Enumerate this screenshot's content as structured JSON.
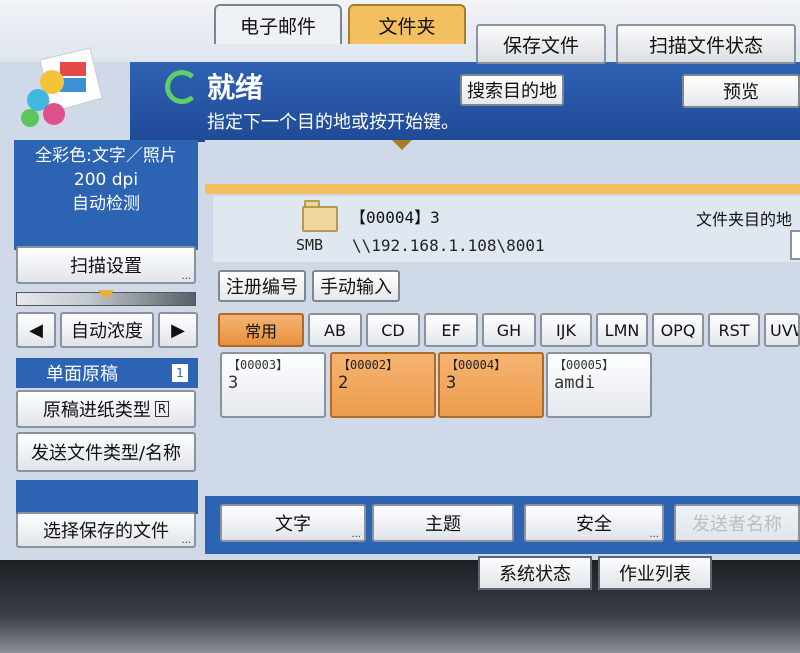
{
  "header": {
    "save_file": "保存文件",
    "scan_status": "扫描文件状态",
    "status": "就绪",
    "hint": "指定下一个目的地或按开始键。",
    "search_dest": "搜索目的地",
    "preview": "预览"
  },
  "left": {
    "color_mode": "全彩色:文字／照片",
    "resolution": "200 dpi",
    "auto_detect": "自动检测",
    "scan_settings": "扫描设置",
    "density_left": "◀",
    "density_label": "自动浓度",
    "density_right": "▶",
    "single_sided": "单面原稿",
    "single_sided_badge": "1",
    "feed_type": "原稿进纸类型",
    "feed_icon": "R",
    "send_type": "发送文件类型/名称",
    "select_saved": "选择保存的文件"
  },
  "tabs": [
    "电子邮件",
    "文件夹"
  ],
  "folder": {
    "id": "【00004】3",
    "protocol": "SMB",
    "path": "\\\\192.168.1.108\\8001",
    "dest_label": "文件夹目的地"
  },
  "actions": {
    "register_no": "注册编号",
    "manual_input": "手动输入"
  },
  "index_tabs": [
    "常用",
    "AB",
    "CD",
    "EF",
    "GH",
    "IJK",
    "LMN",
    "OPQ",
    "RST",
    "UVW"
  ],
  "entries": [
    {
      "num": "【00003】",
      "val": "3",
      "selected": false
    },
    {
      "num": "【00002】",
      "val": "2",
      "selected": true
    },
    {
      "num": "【00004】",
      "val": "3",
      "selected": true
    },
    {
      "num": "【00005】",
      "val": "amdi",
      "selected": false
    }
  ],
  "bottom": {
    "text": "文字",
    "subject": "主题",
    "security": "安全",
    "sender": "发送者名称"
  },
  "system": {
    "system_status": "系统状态",
    "job_list": "作业列表"
  }
}
